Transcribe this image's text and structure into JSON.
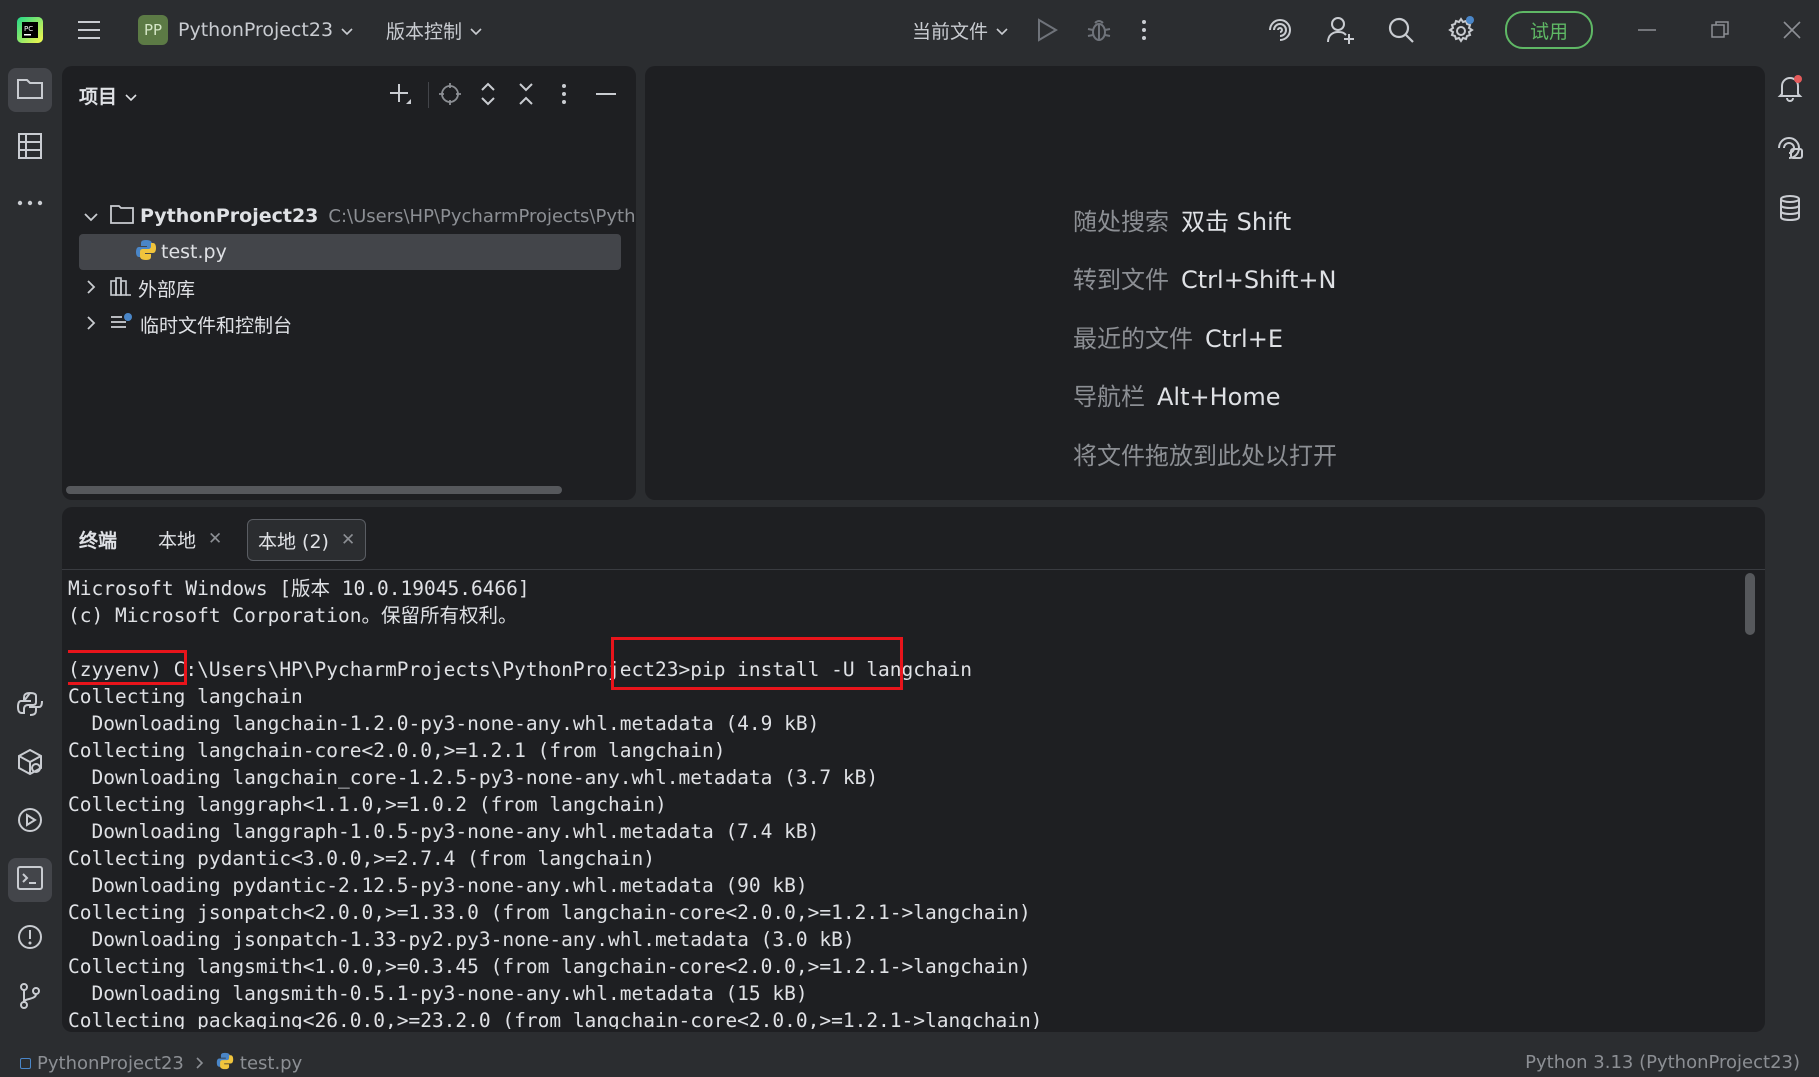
{
  "titlebar": {
    "project_badge": "PP",
    "project_name": "PythonProject23",
    "vcs_menu": "版本控制",
    "run_config": "当前文件",
    "trial_button": "试用"
  },
  "project_panel": {
    "title": "项目",
    "root_name": "PythonProject23",
    "root_path": "C:\\Users\\HP\\PycharmProjects\\PythonPr",
    "file_name": "test.py",
    "external_libs": "外部库",
    "scratches": "临时文件和控制台"
  },
  "welcome": {
    "hints": [
      {
        "label": "随处搜索",
        "key": "双击 Shift"
      },
      {
        "label": "转到文件",
        "key": "Ctrl+Shift+N"
      },
      {
        "label": "最近的文件",
        "key": "Ctrl+E"
      },
      {
        "label": "导航栏",
        "key": "Alt+Home"
      }
    ],
    "drop_text": "将文件拖放到此处以打开"
  },
  "terminal": {
    "title": "终端",
    "tabs": [
      {
        "label": "本地"
      },
      {
        "label": "本地 (2)"
      }
    ],
    "lines": [
      "Microsoft Windows [版本 10.0.19045.6466]",
      "(c) Microsoft Corporation。保留所有权利。",
      "",
      "(zyyenv) C:\\Users\\HP\\PycharmProjects\\PythonProject23>pip install -U langchain",
      "Collecting langchain",
      "  Downloading langchain-1.2.0-py3-none-any.whl.metadata (4.9 kB)",
      "Collecting langchain-core<2.0.0,>=1.2.1 (from langchain)",
      "  Downloading langchain_core-1.2.5-py3-none-any.whl.metadata (3.7 kB)",
      "Collecting langgraph<1.1.0,>=1.0.2 (from langchain)",
      "  Downloading langgraph-1.0.5-py3-none-any.whl.metadata (7.4 kB)",
      "Collecting pydantic<3.0.0,>=2.7.4 (from langchain)",
      "  Downloading pydantic-2.12.5-py3-none-any.whl.metadata (90 kB)",
      "Collecting jsonpatch<2.0.0,>=1.33.0 (from langchain-core<2.0.0,>=1.2.1->langchain)",
      "  Downloading jsonpatch-1.33-py2.py3-none-any.whl.metadata (3.0 kB)",
      "Collecting langsmith<1.0.0,>=0.3.45 (from langchain-core<2.0.0,>=1.2.1->langchain)",
      "  Downloading langsmith-0.5.1-py3-none-any.whl.metadata (15 kB)",
      "Collecting packaging<26.0.0,>=23.2.0 (from langchain-core<2.0.0,>=1.2.1->langchain)"
    ]
  },
  "statusbar": {
    "breadcrumb_project": "PythonProject23",
    "breadcrumb_file": "test.py",
    "interpreter": "Python 3.13 (PythonProject23)"
  },
  "colors": {
    "background": "#2b2d30",
    "panel": "#1e1f22",
    "highlight_box": "#e8141b",
    "trial_green": "#5fb865",
    "python_blue": "#4a86c8",
    "python_yellow": "#f0c43c"
  }
}
